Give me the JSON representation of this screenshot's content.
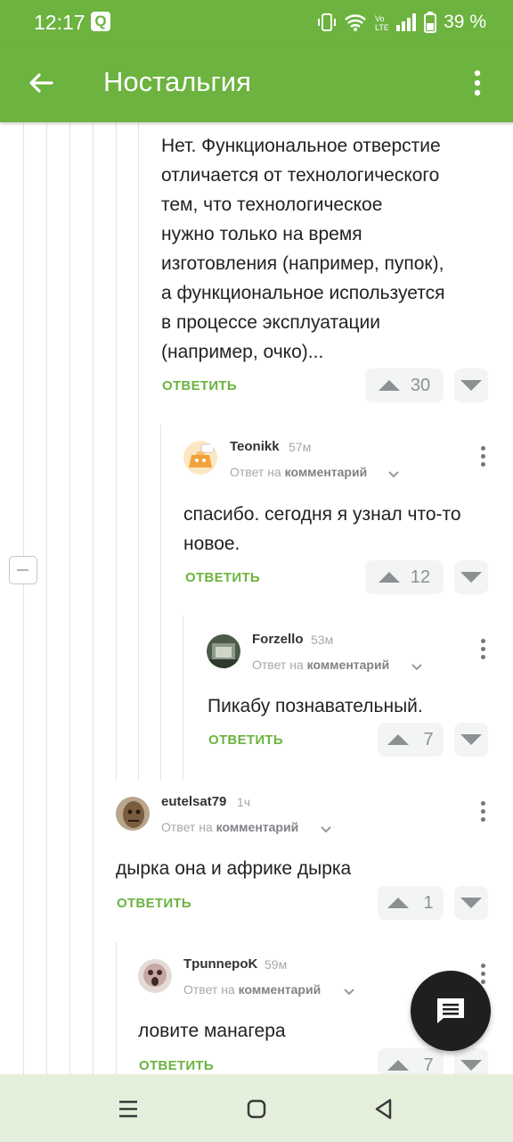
{
  "status_bar": {
    "time": "12:17",
    "notification_badge": "Q",
    "battery_percent": "39 %",
    "icons": [
      "vibrate-icon",
      "wifi-icon",
      "volte-icon",
      "signal-icon",
      "battery-icon"
    ]
  },
  "app_bar": {
    "title": "Ностальгия",
    "back_icon": "arrow-left-icon",
    "menu_icon": "more-vertical-icon",
    "color": "#6cb33f"
  },
  "labels": {
    "reply": "ОТВЕТИТЬ",
    "reply_to_prefix": "Ответ на",
    "reply_to_target": "комментарий"
  },
  "comments": [
    {
      "text_lines": [
        "Нет. Функциональное отверстие",
        "отличается от технологического",
        "тем, что технологическое",
        "нужно только на время",
        "изготовления (например, пупок),",
        "а функциональное используется",
        "в процессе эксплуатации",
        "(например, очко)..."
      ],
      "votes": "30"
    },
    {
      "author": "Teonikk",
      "time": "57м",
      "text_lines": [
        "спасибо. сегодня я узнал что-то",
        "новое."
      ],
      "votes": "12"
    },
    {
      "author": "Forzello",
      "time": "53м",
      "text_lines": [
        "Пикабу познавательный."
      ],
      "votes": "7"
    },
    {
      "author": "eutelsat79",
      "time": "1ч",
      "text_lines": [
        "дырка она и африке дырка"
      ],
      "votes": "1"
    },
    {
      "author": "TpunnepoK",
      "time": "59м",
      "text_lines": [
        "ловите манагера"
      ],
      "votes": "7"
    }
  ],
  "fab": {
    "icon": "message-icon"
  },
  "nav_bar": {
    "icons": [
      "recent-apps-icon",
      "home-icon",
      "back-triangle-icon"
    ],
    "color": "#e5f0dc"
  }
}
